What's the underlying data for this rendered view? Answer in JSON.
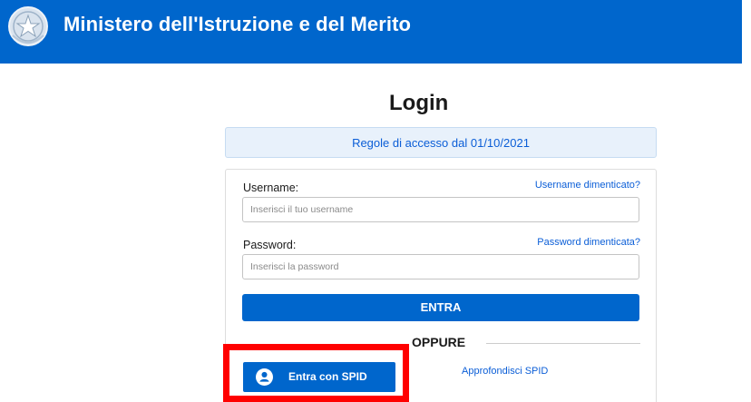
{
  "header": {
    "title": "Ministero dell'Istruzione e del Merito",
    "background_color": "#0066cc",
    "emblem_icon": "italian-republic-emblem-icon"
  },
  "login": {
    "title": "Login",
    "access_rules_link": "Regole di accesso dal 01/10/2021"
  },
  "form": {
    "username_label": "Username:",
    "username_placeholder": "Inserisci il tuo username",
    "username_forgot_link": "Username dimenticato?",
    "password_label": "Password:",
    "password_placeholder": "Inserisci la password",
    "password_forgot_link": "Password dimenticata?",
    "submit_label": "ENTRA",
    "separator_text": "OPPURE"
  },
  "spid": {
    "button_label": "Entra con SPID",
    "button_icon": "user-icon",
    "info_link": "Approfondisci SPID"
  },
  "colors": {
    "primary": "#0066cc",
    "link": "#0b5ed7",
    "highlight": "#ff0000",
    "info_banner_bg": "#e8f1fb"
  }
}
